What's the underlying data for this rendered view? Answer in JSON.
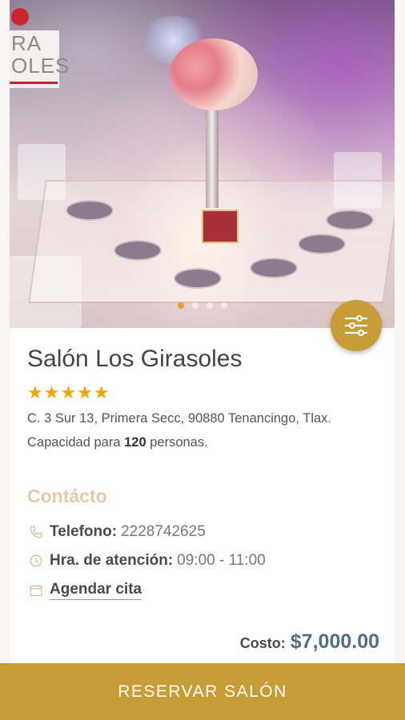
{
  "venue": {
    "name": "Salón Los Girasoles",
    "stars": "★★★★★",
    "rating": 5,
    "address": "C. 3 Sur 13, Primera Secc, 90880 Tenancingo, Tlax.",
    "capacity_prefix": "Capacidad para",
    "capacity_value": "120",
    "capacity_suffix": "personas."
  },
  "hero": {
    "logo_text_line1": "RA",
    "logo_text_line2": "OLES",
    "carousel": {
      "count": 4,
      "active_index": 0
    }
  },
  "contact": {
    "heading": "Contácto",
    "phone_label": "Telefono:",
    "phone_value": "2228742625",
    "hours_label": "Hra. de atención:",
    "hours_value": "09:00 - 11:00",
    "appointment_label": "Agendar cita"
  },
  "cost": {
    "label": "Costo:",
    "value": "$7,000.00"
  },
  "actions": {
    "reserve_label": "RESERVAR SALÓN",
    "filter_icon": "sliders-icon"
  },
  "colors": {
    "accent_gold": "#c89c37",
    "star": "#f2a400",
    "contact_heading": "#e8c9a6",
    "price": "#4f6f8a"
  }
}
